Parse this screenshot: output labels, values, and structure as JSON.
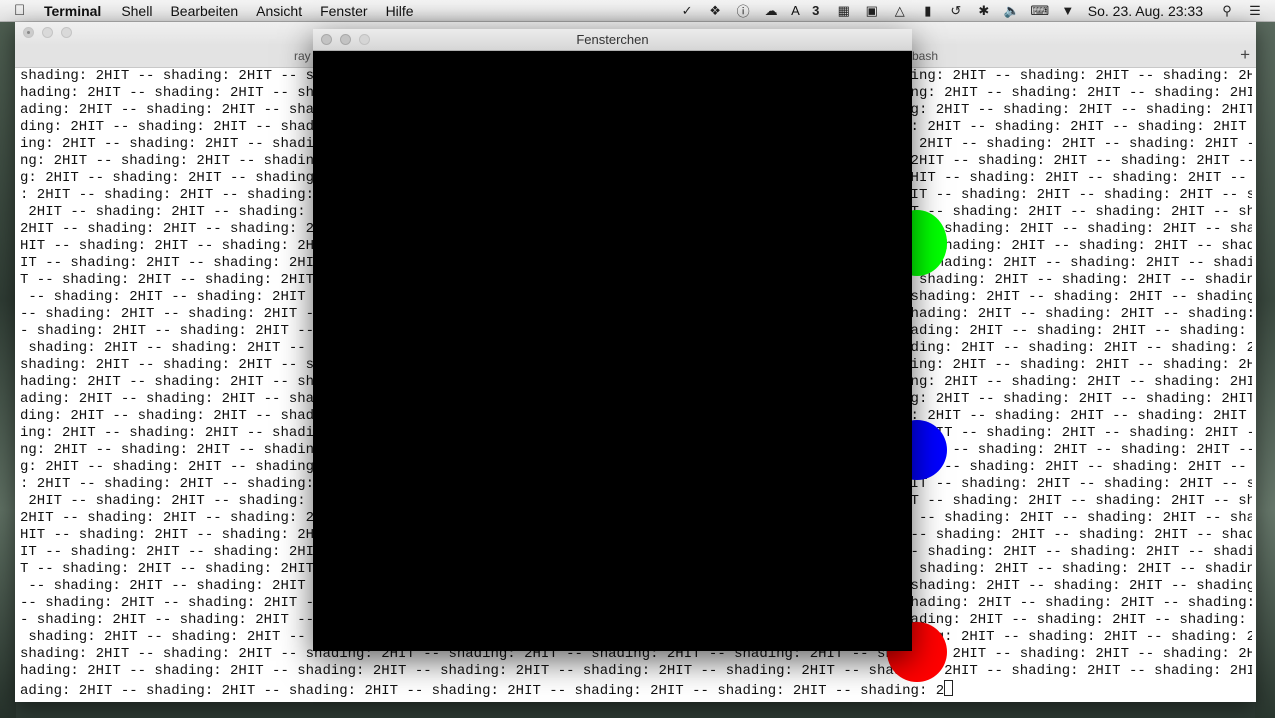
{
  "menubar": {
    "apple_icon": "apple-logo-icon",
    "app_name": "Terminal",
    "items": [
      "Shell",
      "Bearbeiten",
      "Ansicht",
      "Fenster",
      "Hilfe"
    ],
    "status": {
      "badge_count": "3",
      "clock": "So. 23. Aug.  23:33"
    }
  },
  "terminal": {
    "title": "",
    "tabs": {
      "left": "ray",
      "right": "bash"
    },
    "add_tab_symbol": "+",
    "lines": [
      "shading: 2HIT -- shading: 2HIT -- shading: 2HIT -- shading: 2HIT -- shading: 2HIT -- shading: 2HIT -- shading: 2HIT -- shading: 2HIT -- shading: 2HIT -- s",
      "hading: 2HIT -- shading: 2HIT -- shading: 2HIT -- shading: 2HIT -- shading: 2HIT -- shading: 2HIT -- shading: 2HIT -- shading: 2HIT -- shading: 2HIT -- sh",
      "ading: 2HIT -- shading: 2HIT -- shading: 2HIT -- shading: 2HIT -- shading: 2HIT -- shading: 2HIT -- shading: 2HIT -- shading: 2HIT -- shading: 2HIT -- sha",
      "ding: 2HIT -- shading: 2HIT -- shading: 2HIT -- shading: 2HIT -- shading: 2HIT -- shading: 2HIT -- shading: 2HIT -- shading: 2HIT -- shading: 2HIT -- shad",
      "ing: 2HIT -- shading: 2HIT -- shading: 2HIT -- shading: 2HIT -- shading: 2HIT -- shading: 2HIT -- shading: 2HIT -- shading: 2HIT -- shading: 2HIT -- shadi",
      "ng: 2HIT -- shading: 2HIT -- shading: 2HIT -- shading: 2HIT -- shading: 2HIT -- shading: 2HIT -- shading: 2HIT -- shading: 2HIT -- shading: 2HIT -- shadin",
      "g: 2HIT -- shading: 2HIT -- shading: 2HIT -- shading: 2HIT -- shading: 2HIT -- shading: 2HIT -- shading: 2HIT -- shading: 2HIT -- shading: 2HIT -- shading",
      ": 2HIT -- shading: 2HIT -- shading: 2HIT -- shading: 2HIT -- shading: 2HIT -- shading: 2HIT -- shading: 2HIT -- shading: 2HIT -- shading: 2HIT -- shading:",
      " 2HIT -- shading: 2HIT -- shading: 2HIT -- shading: 2HIT -- shading: 2HIT -- shading: 2HIT -- shading: 2HIT -- shading: 2HIT -- shading: 2HIT -- shading: ",
      "2HIT -- shading: 2HIT -- shading: 2HIT -- shading: 2HIT -- shading: 2HIT -- shading: 2HIT -- shading: 2HIT -- shading: 2HIT -- shading: 2HIT -- shading: 2",
      "HIT -- shading: 2HIT -- shading: 2HIT -- shading: 2HIT -- shading: 2HIT -- shading: 2HIT -- shading: 2HIT -- shading: 2HIT -- shading: 2HIT -- shading: 2H",
      "IT -- shading: 2HIT -- shading: 2HIT -- shading: 2HIT -- shading: 2HIT -- shading: 2HIT -- shading: 2HIT -- shading: 2HIT -- shading: 2HIT -- shading: 2HI",
      "T -- shading: 2HIT -- shading: 2HIT -- shading: 2HIT -- shading: 2HIT -- shading: 2HIT -- shading: 2HIT -- shading: 2HIT -- shading: 2HIT -- shading: 2HIT",
      " -- shading: 2HIT -- shading: 2HIT -- shading: 2HIT -- shading: 2HIT -- shading: 2HIT -- shading: 2HIT -- shading: 2HIT -- shading: 2HIT -- shading: 2HIT ",
      "-- shading: 2HIT -- shading: 2HIT -- shading: 2HIT -- shading: 2HIT -- shading: 2HIT -- shading: 2HIT -- shading: 2HIT -- shading: 2HIT -- shading: 2HIT -",
      "- shading: 2HIT -- shading: 2HIT -- shading: 2HIT -- shading: 2HIT -- shading: 2HIT -- shading: 2HIT -- shading: 2HIT -- shading: 2HIT -- shading: 2HIT --",
      " shading: 2HIT -- shading: 2HIT -- shading: 2HIT -- shading: 2HIT -- shading: 2HIT -- shading: 2HIT -- shading: 2HIT -- shading: 2HIT -- shading: 2HIT -- ",
      "shading: 2HIT -- shading: 2HIT -- shading: 2HIT -- shading: 2HIT -- shading: 2HIT -- shading: 2HIT -- shading: 2HIT -- shading: 2HIT -- shading: 2HIT -- s",
      "hading: 2HIT -- shading: 2HIT -- shading: 2HIT -- shading: 2HIT -- shading: 2HIT -- shading: 2HIT -- shading: 2HIT -- shading: 2HIT -- shading: 2HIT -- sh",
      "ading: 2HIT -- shading: 2HIT -- shading: 2HIT -- shading: 2HIT -- shading: 2HIT -- shading: 2HIT -- shading: 2HIT -- shading: 2HIT -- shading: 2HIT -- sha",
      "ding: 2HIT -- shading: 2HIT -- shading: 2HIT -- shading: 2HIT -- shading: 2HIT -- shading: 2HIT -- shading: 2HIT -- shading: 2HIT -- shading: 2HIT -- shad",
      "ing: 2HIT -- shading: 2HIT -- shading: 2HIT -- shading: 2HIT -- shading: 2HIT -- shading: 2HIT -- shading: 2HIT -- shading: 2HIT -- shading: 2HIT -- shadi",
      "ng: 2HIT -- shading: 2HIT -- shading: 2HIT -- shading: 2HIT -- shading: 2HIT -- shading: 2HIT -- shading: 2HIT -- shading: 2HIT -- shading: 2HIT -- shadin",
      "g: 2HIT -- shading: 2HIT -- shading: 2HIT -- shading: 2HIT -- shading: 2HIT -- shading: 2HIT -- shading: 2HIT -- shading: 2HIT -- shading: 2HIT -- shading",
      ": 2HIT -- shading: 2HIT -- shading: 2HIT -- shading: 2HIT -- shading: 2HIT -- shading: 2HIT -- shading: 2HIT -- shading: 2HIT -- shading: 2HIT -- shading:",
      " 2HIT -- shading: 2HIT -- shading: 2HIT -- shading: 2HIT -- shading: 2HIT -- shading: 2HIT -- shading: 2HIT -- shading: 2HIT -- shading: 2HIT -- shading: ",
      "2HIT -- shading: 2HIT -- shading: 2HIT -- shading: 2HIT -- shading: 2HIT -- shading: 2HIT -- shading: 2HIT -- shading: 2HIT -- shading: 2HIT -- shading: 2",
      "HIT -- shading: 2HIT -- shading: 2HIT -- shading: 2HIT -- shading: 2HIT -- shading: 2HIT -- shading: 2HIT -- shading: 2HIT -- shading: 2HIT -- shading: 2H",
      "IT -- shading: 2HIT -- shading: 2HIT -- shading: 2HIT -- shading: 2HIT -- shading: 2HIT -- shading: 2HIT -- shading: 2HIT -- shading: 2HIT -- shading: 2HI",
      "T -- shading: 2HIT -- shading: 2HIT -- shading: 2HIT -- shading: 2HIT -- shading: 2HIT -- shading: 2HIT -- shading: 2HIT -- shading: 2HIT -- shading: 2HIT",
      " -- shading: 2HIT -- shading: 2HIT -- shading: 2HIT -- shading: 2HIT -- shading: 2HIT -- shading: 2HIT -- shading: 2HIT -- shading: 2HIT -- shading: 2HIT ",
      "-- shading: 2HIT -- shading: 2HIT -- shading: 2HIT -- shading: 2HIT -- shading: 2HIT -- shading: 2HIT -- shading: 2HIT -- shading: 2HIT -- shading: 2HIT -",
      "- shading: 2HIT -- shading: 2HIT -- shading: 2HIT -- shading: 2HIT -- shading: 2HIT -- shading: 2HIT -- shading: 2HIT -- shading: 2HIT -- shading: 2HIT --",
      " shading: 2HIT -- shading: 2HIT -- shading: 2HIT -- shading: 2HIT -- shading: 2HIT -- shading: 2HIT -- shading: 2HIT -- shading: 2HIT -- shading: 2HIT -- ",
      "shading: 2HIT -- shading: 2HIT -- shading: 2HIT -- shading: 2HIT -- shading: 2HIT -- shading: 2HIT -- shading: 2HIT -- shading: 2HIT -- shading: 2HIT -- s",
      "hading: 2HIT -- shading: 2HIT -- shading: 2HIT -- shading: 2HIT -- shading: 2HIT -- shading: 2HIT -- shading: 2HIT -- shading: 2HIT -- shading: 2HIT -- sh",
      "ading: 2HIT -- shading: 2HIT -- shading: 2HIT -- shading: 2HIT -- shading: 2HIT -- shading: 2HIT -- shading: 2"
    ]
  },
  "fensterchen": {
    "title": "Fensterchen",
    "spheres": [
      {
        "name": "green-sphere",
        "color": "#00ff00"
      },
      {
        "name": "blue-sphere",
        "color": "#0000ff"
      },
      {
        "name": "red-sphere",
        "color": "#ff0000"
      }
    ]
  }
}
